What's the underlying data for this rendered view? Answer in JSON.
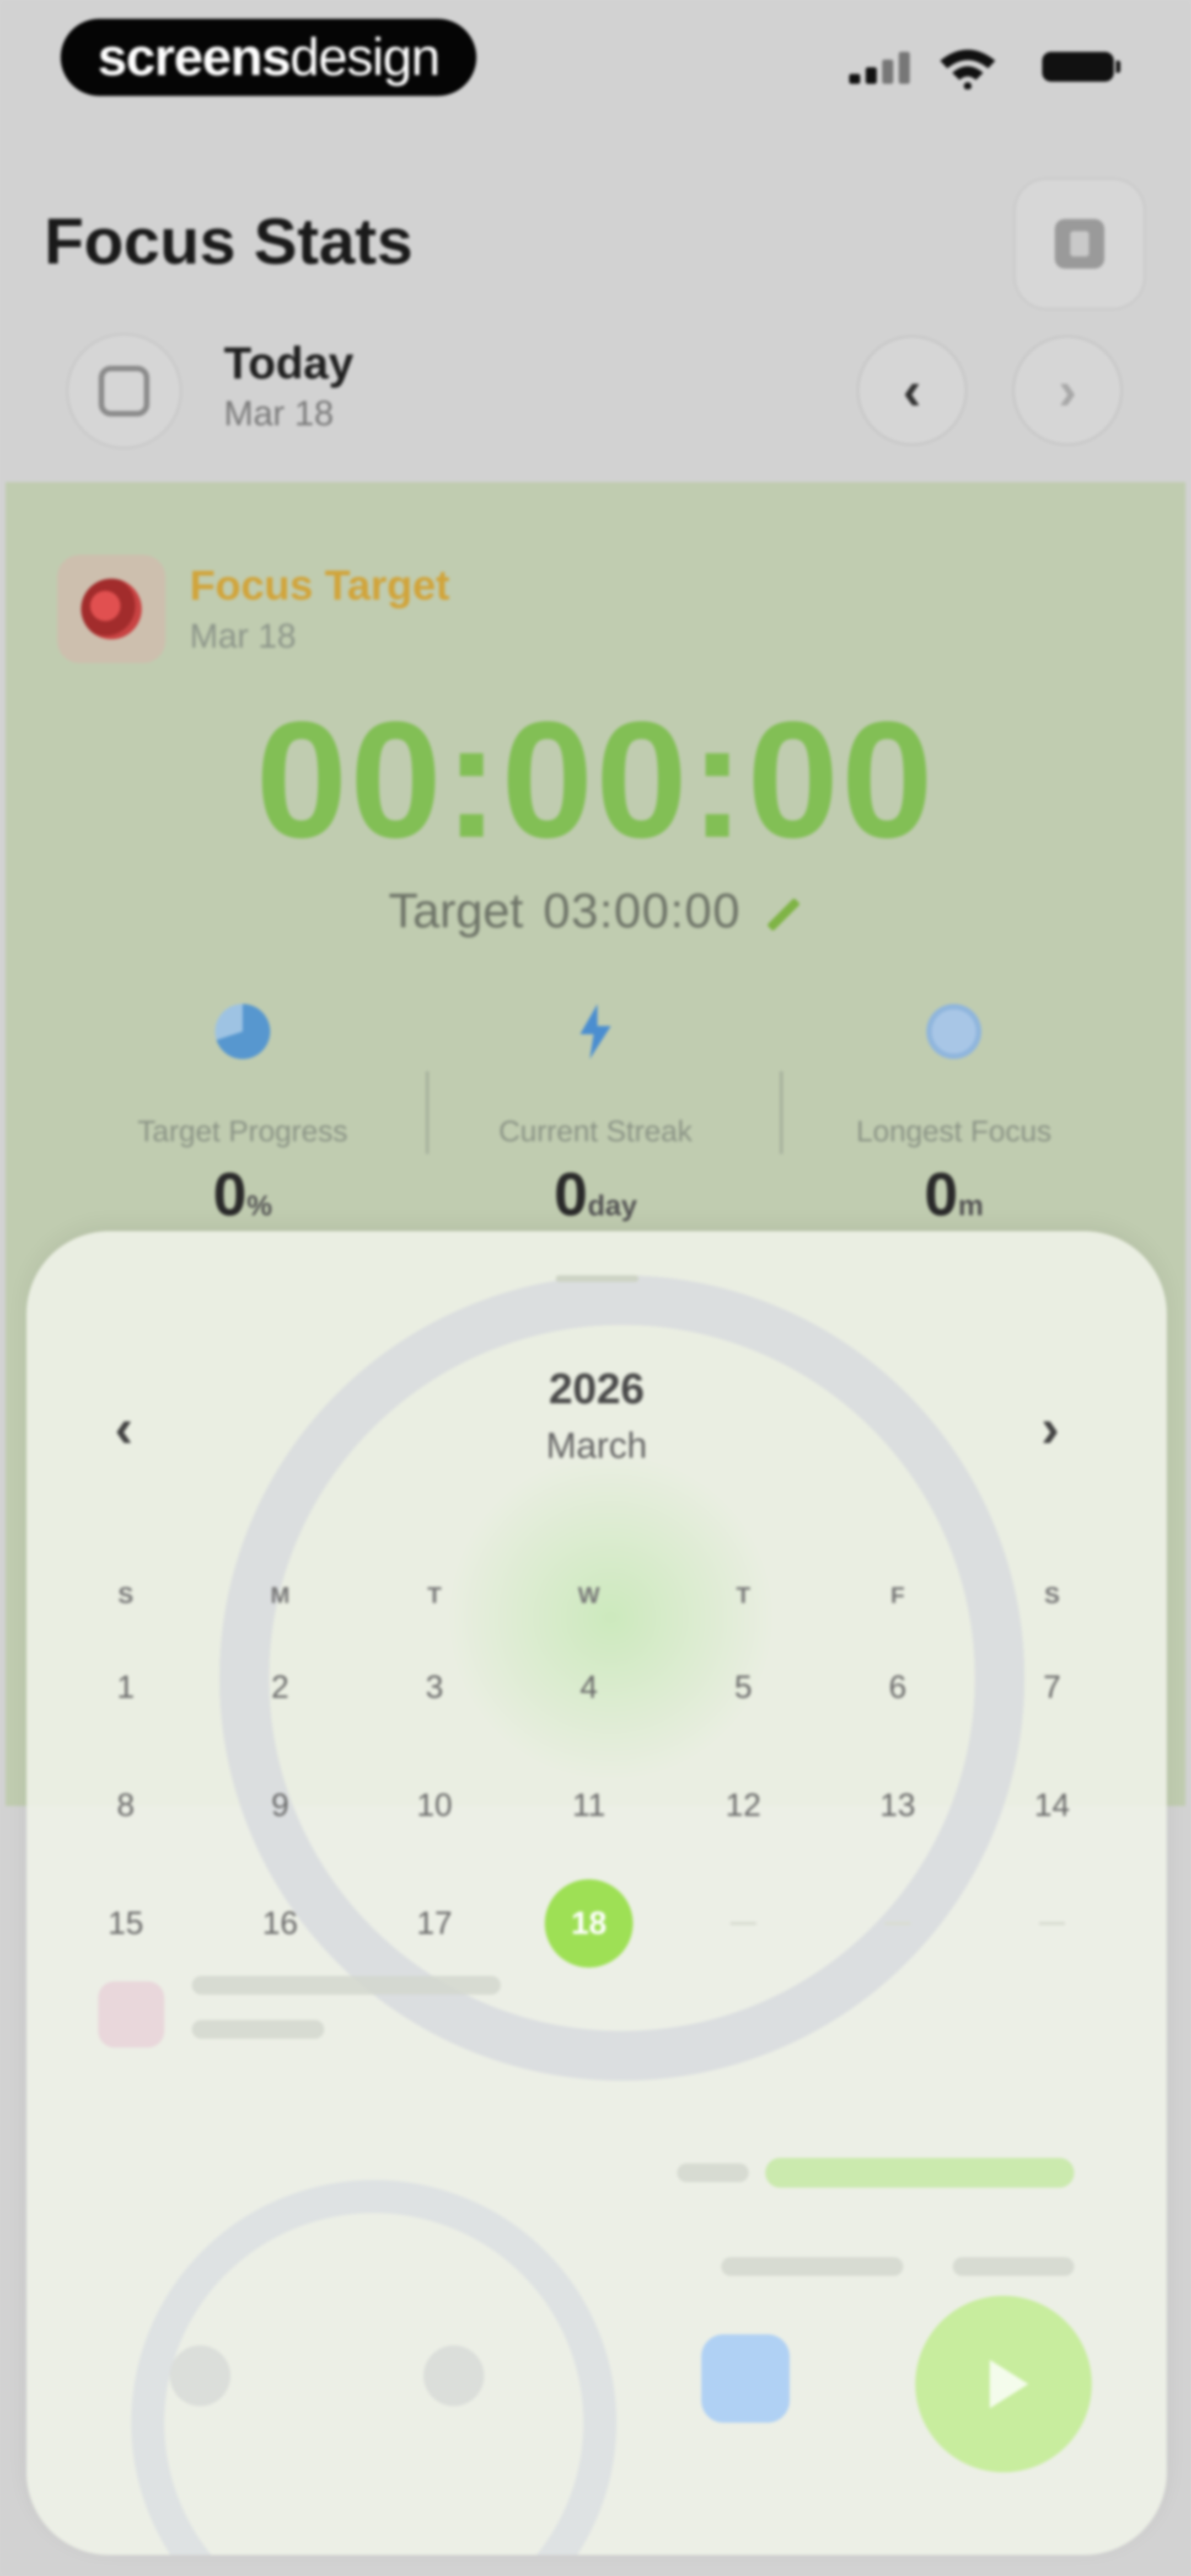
{
  "status_bar": {
    "brand_part1": "screens",
    "brand_part2": "design"
  },
  "header": {
    "title": "Focus Stats"
  },
  "date_selector": {
    "title": "Today",
    "subtitle": "Mar 18",
    "prev_symbol": "‹",
    "next_symbol": "›"
  },
  "focus_card": {
    "label": "Focus Target",
    "date": "Mar 18",
    "timer": "00:00:00",
    "target_label": "Target",
    "target_value": "03:00:00",
    "stats": [
      {
        "icon": "pie-chart-icon",
        "label": "Target Progress",
        "value": "0",
        "unit": "%"
      },
      {
        "icon": "lightning-icon",
        "label": "Current Streak",
        "value": "0",
        "unit": "day"
      },
      {
        "icon": "clock-icon",
        "label": "Longest Focus",
        "value": "0",
        "unit": "m"
      }
    ]
  },
  "calendar": {
    "year": "2026",
    "month": "March",
    "prev_symbol": "‹",
    "next_symbol": "›",
    "weekdays": [
      "S",
      "M",
      "T",
      "W",
      "T",
      "F",
      "S"
    ],
    "selected_day": "18",
    "days": [
      "1",
      "2",
      "3",
      "4",
      "5",
      "6",
      "7",
      "8",
      "9",
      "10",
      "11",
      "12",
      "13",
      "14",
      "15",
      "16",
      "17",
      "18"
    ],
    "trailing_empty_cells": 3
  },
  "colors": {
    "accent_green": "#82bf55",
    "selected_day": "#9ee055",
    "target_label": "#d1a43a"
  }
}
